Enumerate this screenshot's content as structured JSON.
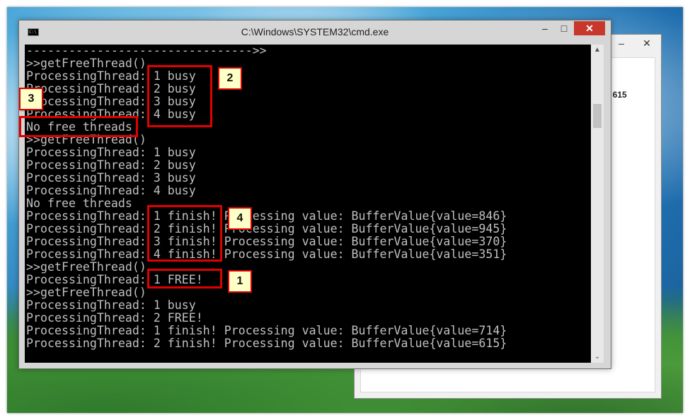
{
  "window": {
    "title": "C:\\Windows\\SYSTEM32\\cmd.exe",
    "minimize_label": "–",
    "maximize_label": "□",
    "close_label": "✕"
  },
  "background_window": {
    "minimize_label": "–",
    "maximize_label": "□",
    "close_label": "✕",
    "value_text": "14 615"
  },
  "console": {
    "lines": [
      "-------------------------------->>",
      ">>getFreeThread()",
      "ProcessingThread: 1 busy",
      "ProcessingThread: 2 busy",
      "ProcessingThread: 3 busy",
      "ProcessingThread: 4 busy",
      "No free threads",
      ">>getFreeThread()",
      "ProcessingThread: 1 busy",
      "ProcessingThread: 2 busy",
      "ProcessingThread: 3 busy",
      "ProcessingThread: 4 busy",
      "No free threads",
      "ProcessingThread: 1 finish! Processing value: BufferValue{value=846}",
      "ProcessingThread: 2 finish! Processing value: BufferValue{value=945}",
      "ProcessingThread: 3 finish! Processing value: BufferValue{value=370}",
      "ProcessingThread: 4 finish! Processing value: BufferValue{value=351}",
      ">>getFreeThread()",
      "ProcessingThread: 1 FREE!",
      ">>getFreeThread()",
      "ProcessingThread: 1 busy",
      "ProcessingThread: 2 FREE!",
      "ProcessingThread: 1 finish! Processing value: BufferValue{value=714}",
      "ProcessingThread: 2 finish! Processing value: BufferValue{value=615}"
    ]
  },
  "annotations": {
    "badge_1": "1",
    "badge_2": "2",
    "badge_3": "3",
    "badge_4": "4",
    "color": "#e00000"
  },
  "icons": {
    "app": "cmd-app-icon",
    "scroll_up": "▲",
    "scroll_down": "⌄"
  }
}
